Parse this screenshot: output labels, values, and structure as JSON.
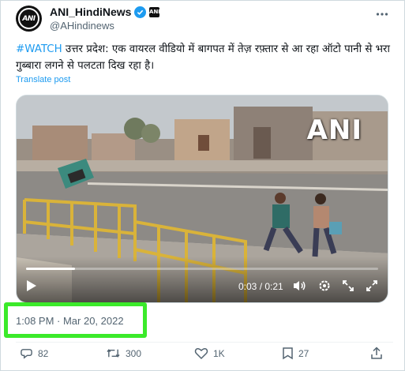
{
  "account": {
    "display_name": "ANI_HindiNews",
    "handle": "@AHindinews",
    "avatar_text": "ANI",
    "affiliate_badge_text": "ANI"
  },
  "tweet": {
    "hashtag": "#WATCH",
    "text": " उत्तर प्रदेश: एक वायरल वीडियो में बागपत में तेज़ रफ़्तार से आ रहा ऑटो पानी से भरा गुब्बारा लगने से पलटता दिख रहा है।",
    "translate_label": "Translate post",
    "timestamp": "1:08 PM · Mar 20, 2022"
  },
  "video": {
    "watermark": "ANI",
    "time_display": "0:03 / 0:21",
    "progress_fraction": 0.14
  },
  "actions": {
    "replies": "82",
    "reposts": "300",
    "likes": "1K",
    "bookmarks": "27"
  },
  "colors": {
    "accent": "#1d9bf0",
    "highlight": "#3bea2a",
    "muted": "#536471",
    "text": "#0f1419"
  },
  "icons": [
    "verified-badge-icon",
    "more-icon",
    "play-icon",
    "volume-icon",
    "settings-icon",
    "expand-icon",
    "fullscreen-icon",
    "reply-icon",
    "repost-icon",
    "like-icon",
    "bookmark-icon",
    "share-icon"
  ]
}
